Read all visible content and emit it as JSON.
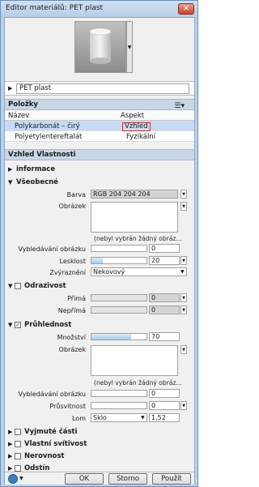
{
  "window": {
    "title": "Editor materiálů: PET plast",
    "close_glyph": "✕"
  },
  "material": {
    "name": "PET plast"
  },
  "polozky": {
    "header": "Položky",
    "columns": [
      "Název",
      "Aspekt"
    ],
    "rows": [
      {
        "name": "Polykarbonát – čirý",
        "aspect": "Vzhled",
        "selected": true
      },
      {
        "name": "Polyetylentereftalát",
        "aspect": "Fyzikální",
        "selected": false
      }
    ]
  },
  "vzhled": {
    "header": "Vzhled Vlastnosti",
    "informace": "informace",
    "vseobecne": {
      "label": "Všeobecné",
      "barva_label": "Barva",
      "barva_value": "RGB 204 204 204",
      "obrazek_label": "Obrázek",
      "obrazek_note": "(nebyl vybrán žádný obráz...",
      "vybledavani_label": "Vybledávání obrázku",
      "vybledavani_value": "0",
      "lesklost_label": "Lesklost",
      "lesklost_value": "20",
      "zvyrazneni_label": "Zvýraznění",
      "zvyrazneni_value": "Nekovový"
    },
    "odrazivost": {
      "label": "Odrazivost",
      "prima_label": "Přímá",
      "prima_value": "0",
      "neprima_label": "Nepřímá",
      "neprima_value": "0"
    },
    "pruhlednost": {
      "label": "Průhlednost",
      "checked_glyph": "✓",
      "mnozstvi_label": "Množství",
      "mnozstvi_value": "70",
      "obrazek_label": "Obrázek",
      "obrazek_note": "(nebyl vybrán žádný obráz...",
      "vybledavani_label": "Vybledávání obrázku",
      "vybledavani_value": "0",
      "prusvitnost_label": "Průsvitnost",
      "prusvitnost_value": "0",
      "lom_label": "Lom",
      "lom_value": "Sklo",
      "lom_number": "1,52"
    },
    "vyjmute": "Vyjmuté části",
    "svitivost": "Vlastní svítivost",
    "nerovnost": "Nerovnost",
    "odstin": "Odstín"
  },
  "buttons": {
    "ok": "OK",
    "storno": "Storno",
    "pouzit": "Použít"
  }
}
